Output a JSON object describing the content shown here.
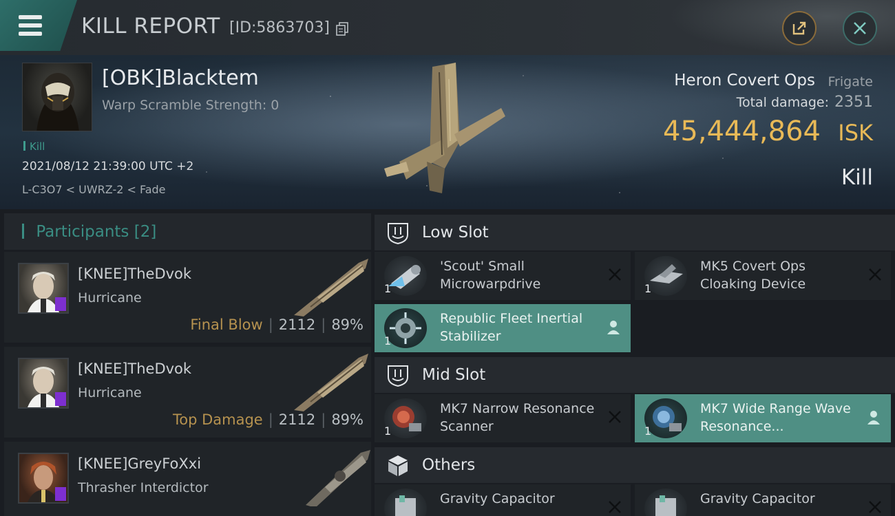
{
  "header": {
    "title": "KILL REPORT",
    "report_id": "[ID:5863703]"
  },
  "victim": {
    "name": "[OBK]Blacktem",
    "warp_scramble": "Warp Scramble Strength: 0",
    "tag": "Kill",
    "datetime": "2021/08/12 21:39:00 UTC +2",
    "location": "L-C3O7 < UWRZ-2 < Fade",
    "ship_name": "Heron Covert Ops",
    "ship_class": "Frigate",
    "total_damage_label": "Total damage:",
    "total_damage": "2351",
    "isk_value": "45,444,864",
    "isk_unit": "ISK",
    "report_type": "Kill"
  },
  "participants": {
    "title": "Participants",
    "count": "[2]",
    "rows": [
      {
        "name": "[KNEE]TheDvok",
        "ship": "Hurricane",
        "label": "Final Blow",
        "damage": "2112",
        "percent": "89%"
      },
      {
        "name": "[KNEE]TheDvok",
        "ship": "Hurricane",
        "label": "Top Damage",
        "damage": "2112",
        "percent": "89%"
      },
      {
        "name": "[KNEE]GreyFoXxi",
        "ship": "Thrasher Interdictor"
      }
    ]
  },
  "fitting": {
    "low_slot": {
      "title": "Low Slot",
      "modules": [
        {
          "name": "'Scout' Small Microwarpdrive",
          "qty": "1",
          "status": "destroyed"
        },
        {
          "name": "MK5 Covert Ops Cloaking Device",
          "qty": "1",
          "status": "destroyed"
        },
        {
          "name": "Republic Fleet Inertial Stabilizer",
          "qty": "1",
          "status": "dropped"
        }
      ]
    },
    "mid_slot": {
      "title": "Mid Slot",
      "modules": [
        {
          "name": "MK7 Narrow Resonance Scanner",
          "qty": "1",
          "status": "destroyed"
        },
        {
          "name": "MK7 Wide Range Wave Resonance...",
          "qty": "1",
          "status": "dropped"
        }
      ]
    },
    "others": {
      "title": "Others",
      "modules": [
        {
          "name": "Gravity Capacitor",
          "status": "destroyed"
        },
        {
          "name": "Gravity Capacitor",
          "status": "destroyed"
        }
      ]
    }
  },
  "colors": {
    "accent_teal": "#3a8d83",
    "isk_gold": "#e8b957",
    "dropped_bg": "#4f8f84",
    "label_gold": "#b6924f"
  },
  "icons": {
    "menu": "hamburger-icon",
    "copy": "copy-icon",
    "share": "share-icon",
    "close": "close-icon",
    "destroyed": "x-icon",
    "dropped": "user-icon",
    "low_slot": "low-slot-icon",
    "mid_slot": "mid-slot-icon",
    "others": "cube-icon"
  }
}
